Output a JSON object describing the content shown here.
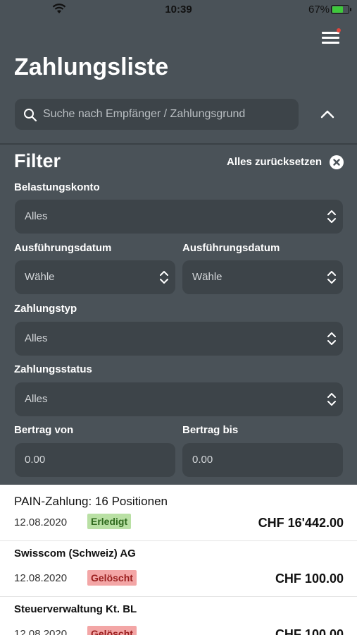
{
  "status_bar": {
    "time": "10:39",
    "battery": "67%"
  },
  "header": {
    "title": "Zahlungsliste"
  },
  "search": {
    "placeholder": "Suche nach Empfänger / Zahlungsgrund"
  },
  "filter": {
    "title": "Filter",
    "reset_label": "Alles zurücksetzen",
    "belastungskonto": {
      "label": "Belastungskonto",
      "value": "Alles"
    },
    "date_from": {
      "label": "Ausführungsdatum",
      "value": "Wähle"
    },
    "date_to": {
      "label": "Ausführungsdatum",
      "value": "Wähle"
    },
    "zahlungstyp": {
      "label": "Zahlungstyp",
      "value": "Alles"
    },
    "zahlungsstatus": {
      "label": "Zahlungsstatus",
      "value": "Alles"
    },
    "betrag_von": {
      "label": "Bertrag von",
      "value": "0.00"
    },
    "betrag_bis": {
      "label": "Bertrag bis",
      "value": "0.00"
    }
  },
  "payments": [
    {
      "title": "PAIN-Zahlung: 16 Positionen",
      "date": "12.08.2020",
      "status": "Erledigt",
      "amount": "CHF 16'442.00"
    },
    {
      "title": "Swisscom (Schweiz) AG",
      "date": "12.08.2020",
      "status": "Gelöscht",
      "amount": "CHF 100.00"
    },
    {
      "title": "Steuerverwaltung Kt. BL",
      "date": "12.08.2020",
      "status": "Gelöscht",
      "amount": "CHF 100.00"
    }
  ],
  "colors": {
    "panel": "#4a5258",
    "field": "#3d4449",
    "done_badge": "#b9e0a4",
    "deleted_badge": "#f3a6a6"
  }
}
